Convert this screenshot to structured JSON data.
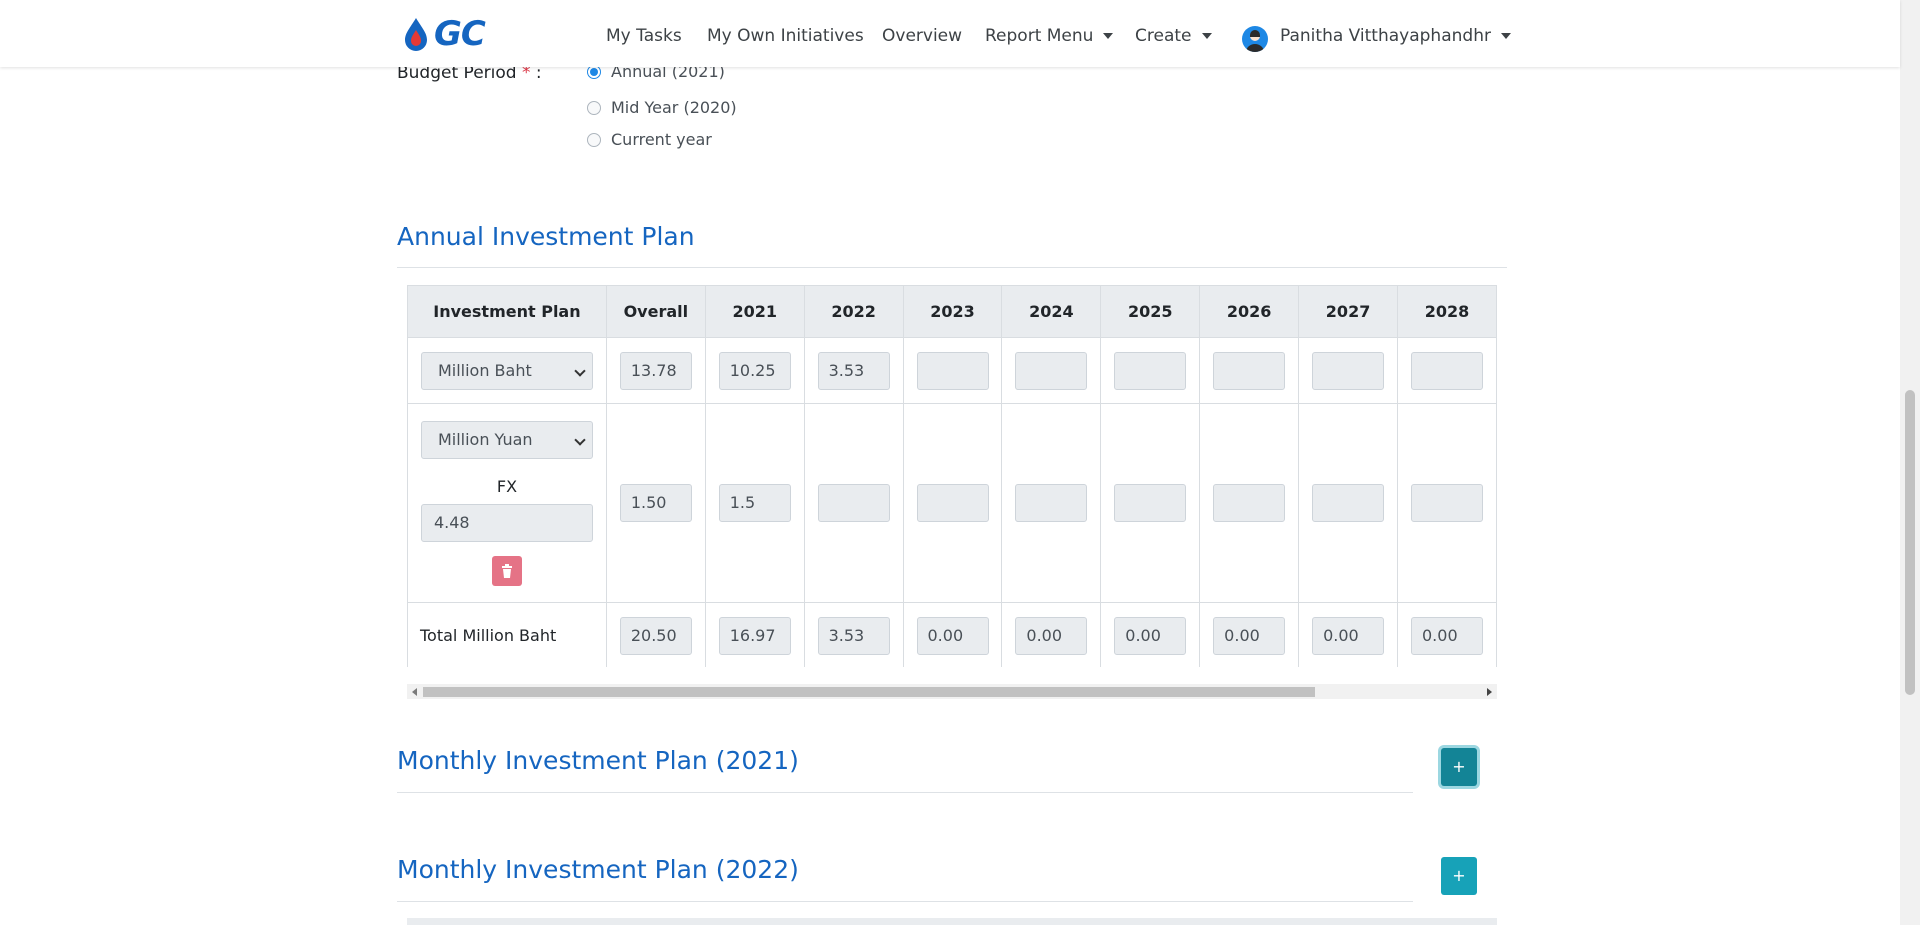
{
  "navbar": {
    "logo_text": "GC",
    "items": [
      "My Tasks",
      "My Own Initiatives",
      "Overview",
      "Report Menu",
      "Create"
    ],
    "user_name": "Panitha Vitthayaphandhr"
  },
  "budget_period": {
    "label": "Budget Period",
    "required_mark": "*",
    "colon": ":",
    "options": [
      "Annual (2021)",
      "Mid Year (2020)",
      "Current year"
    ],
    "selected": "Annual (2021)"
  },
  "annual_plan": {
    "title": "Annual Investment Plan",
    "headers": [
      "Investment Plan",
      "Overall",
      "2021",
      "2022",
      "2023",
      "2024",
      "2025",
      "2026",
      "2027",
      "2028"
    ],
    "row1": {
      "currency": "Million Baht",
      "values": [
        "13.78",
        "10.25",
        "3.53",
        "",
        "",
        "",
        "",
        "",
        ""
      ]
    },
    "row2": {
      "currency": "Million Yuan",
      "fx_label": "FX",
      "fx_value": "4.48",
      "values": [
        "1.50",
        "1.5",
        "",
        "",
        "",
        "",
        "",
        "",
        ""
      ]
    },
    "total": {
      "label": "Total Million Baht",
      "values": [
        "20.50",
        "16.97",
        "3.53",
        "0.00",
        "0.00",
        "0.00",
        "0.00",
        "0.00",
        "0.00"
      ]
    }
  },
  "monthly_2021": {
    "title": "Monthly Investment Plan (2021)",
    "button": "+"
  },
  "monthly_2022": {
    "title": "Monthly Investment Plan (2022)",
    "button": "+"
  },
  "colors": {
    "accent": "#1565c0",
    "teal": "#17a2b8",
    "danger": "#e57386"
  }
}
